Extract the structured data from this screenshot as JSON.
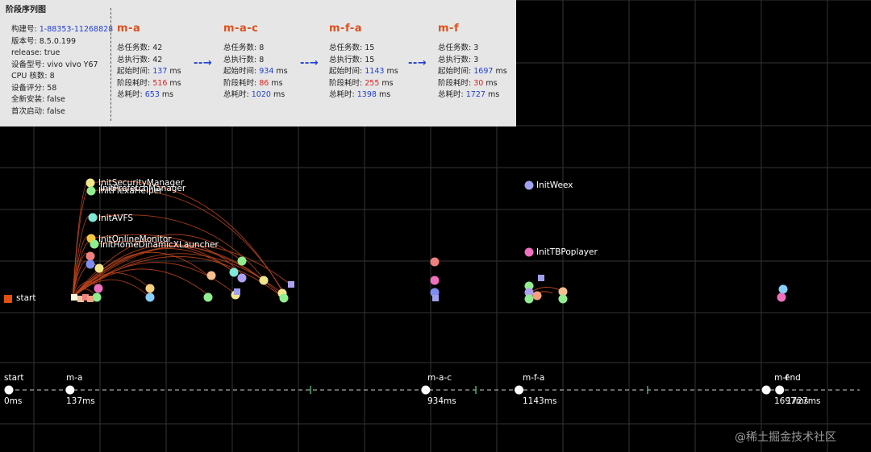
{
  "panel": {
    "title": "阶段序列图",
    "info": [
      {
        "label": "构建号: ",
        "value": "1-88353-11268828",
        "value_color": "blue"
      },
      {
        "label": "版本号: ",
        "value": "8.5.0.199",
        "value_color": ""
      },
      {
        "label": "release: ",
        "value": "true",
        "value_color": ""
      },
      {
        "label": "设备型号: ",
        "value": "vivo vivo Y67",
        "value_color": ""
      },
      {
        "label": "CPU 核数: ",
        "value": "8",
        "value_color": ""
      },
      {
        "label": "设备评分: ",
        "value": "58",
        "value_color": ""
      },
      {
        "label": "全新安装: ",
        "value": "false",
        "value_color": ""
      },
      {
        "label": "首次启动: ",
        "value": "false",
        "value_color": ""
      }
    ],
    "stages": [
      {
        "name": "m-a",
        "rows": [
          {
            "label": "总任务数: ",
            "value": "42",
            "color": ""
          },
          {
            "label": "总执行数: ",
            "value": "42",
            "color": ""
          },
          {
            "label": "起始时间: ",
            "value": "137",
            "color": "blue",
            "unit": " ms"
          },
          {
            "label": "阶段耗时: ",
            "value": "516",
            "color": "red",
            "unit": " ms"
          },
          {
            "label": "总耗时: ",
            "value": "653",
            "color": "blue",
            "unit": " ms"
          }
        ]
      },
      {
        "name": "m-a-c",
        "rows": [
          {
            "label": "总任务数: ",
            "value": "8",
            "color": ""
          },
          {
            "label": "总执行数: ",
            "value": "8",
            "color": ""
          },
          {
            "label": "起始时间: ",
            "value": "934",
            "color": "blue",
            "unit": " ms"
          },
          {
            "label": "阶段耗时: ",
            "value": "86",
            "color": "red",
            "unit": " ms"
          },
          {
            "label": "总耗时: ",
            "value": "1020",
            "color": "blue",
            "unit": " ms"
          }
        ]
      },
      {
        "name": "m-f-a",
        "rows": [
          {
            "label": "总任务数: ",
            "value": "15",
            "color": ""
          },
          {
            "label": "总执行数: ",
            "value": "15",
            "color": ""
          },
          {
            "label": "起始时间: ",
            "value": "1143",
            "color": "blue",
            "unit": " ms"
          },
          {
            "label": "阶段耗时: ",
            "value": "255",
            "color": "red",
            "unit": " ms"
          },
          {
            "label": "总耗时: ",
            "value": "1398",
            "color": "blue",
            "unit": " ms"
          }
        ]
      },
      {
        "name": "m-f",
        "rows": [
          {
            "label": "总任务数: ",
            "value": "3",
            "color": ""
          },
          {
            "label": "总执行数: ",
            "value": "3",
            "color": ""
          },
          {
            "label": "起始时间: ",
            "value": "1697",
            "color": "blue",
            "unit": " ms"
          },
          {
            "label": "阶段耗时: ",
            "value": "30",
            "color": "red",
            "unit": " ms"
          },
          {
            "label": "总耗时: ",
            "value": "1727",
            "color": "blue",
            "unit": " ms"
          }
        ]
      }
    ],
    "arrow": "- - →"
  },
  "start_node": {
    "label": "start",
    "color": "#e05010"
  },
  "tasks": [
    {
      "name": "InitSecurityManager",
      "color": "#f0e68c"
    },
    {
      "name": "InitPrefetchManager",
      "color": "#b0a0f0"
    },
    {
      "name": "InitFlexaHelper",
      "color": "#90ee90"
    },
    {
      "name": "InitAVFS",
      "color": "#7fe8d8"
    },
    {
      "name": "InitOnlineMonitor",
      "color": "#f5c842"
    },
    {
      "name": "InitHomeDinamicXLauncher",
      "color": "#90ee90"
    },
    {
      "name": "InitWeex",
      "color": "#a0a0f0"
    },
    {
      "name": "InitTBPoplayer",
      "color": "#f070c0"
    }
  ],
  "timeline": {
    "markers": [
      {
        "name": "start",
        "time": "0ms",
        "t": 0
      },
      {
        "name": "m-a",
        "time": "137ms",
        "t": 137
      },
      {
        "name": "m-a-c",
        "time": "934ms",
        "t": 934
      },
      {
        "name": "m-f-a",
        "time": "1143ms",
        "t": 1143
      },
      {
        "name": "m-f",
        "time": "1697ms",
        "t": 1697
      },
      {
        "name": "end",
        "time": "1727ms",
        "t": 1727
      }
    ],
    "tick_color": "#3cb371"
  },
  "colors": {
    "background": "#000000",
    "grid": "#333333",
    "panel": "#e6e6e6",
    "stage_name": "#e0501e",
    "edge": "#c0451c",
    "accent_blue": "#1f3fd6",
    "accent_red": "#e02020"
  },
  "watermark": "@稀土掘金技术社区"
}
